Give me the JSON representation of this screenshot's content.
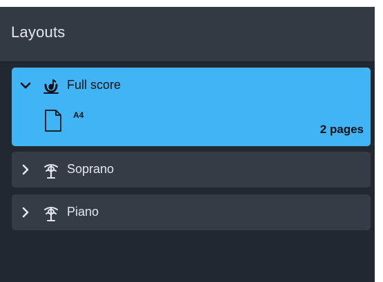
{
  "panel": {
    "title": "Layouts"
  },
  "layouts": [
    {
      "name": "Full score",
      "expanded": true,
      "selected": true,
      "icon": "full-score-icon",
      "page_size": "A4",
      "page_count": "2 pages"
    },
    {
      "name": "Soprano",
      "expanded": false,
      "selected": false,
      "icon": "part-icon"
    },
    {
      "name": "Piano",
      "expanded": false,
      "selected": false,
      "icon": "part-icon"
    }
  ],
  "colors": {
    "panel_background": "#222830",
    "header_background": "#333a43",
    "selected_background": "#41b4f6",
    "item_background": "#353c46",
    "text_light": "#e4e8ee",
    "text_dark": "#0d1115"
  }
}
